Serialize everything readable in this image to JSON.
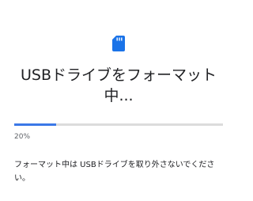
{
  "dialog": {
    "icon": "sd-card-icon",
    "accent_color": "#3b78e7",
    "title": "USBドライブをフォーマット中...",
    "progress": {
      "value": 0.2,
      "label": "20%"
    },
    "message": "フォーマット中は USBドライブを取り外さないでください。"
  }
}
